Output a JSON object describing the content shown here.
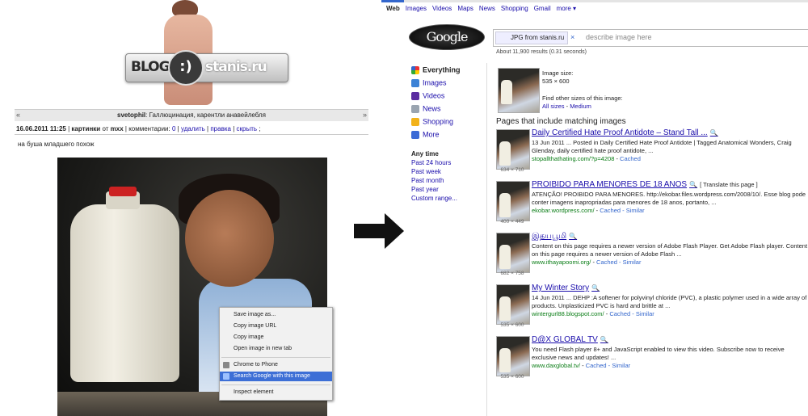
{
  "left": {
    "logo": {
      "left": "BLOG",
      "mid": ":)",
      "right": "stanis.ru"
    },
    "post_nav": {
      "prev": "«",
      "next": "»"
    },
    "post_author": "svetophil",
    "post_title_rest": ": Галлюцинация, карентли анавейлебля",
    "meta": {
      "date": "16.06.2011 11:25",
      "sep1": "|",
      "category": "картинки",
      "from": "от",
      "user": "mxx",
      "sep2": "|",
      "comments": "комментарии:",
      "comments_count": "0",
      "sep3": "|",
      "delete": "удалить",
      "sep4": "|",
      "edit": "правка",
      "sep5": "|",
      "hide": "скрыть",
      "end": ";"
    },
    "post_text": "на буша младшего похож",
    "context_menu": [
      "Save image as...",
      "Copy image URL",
      "Copy image",
      "Open image in new tab",
      "Chrome to Phone",
      "Search Google with this image",
      "Inspect element"
    ]
  },
  "right": {
    "nav": [
      "Web",
      "Images",
      "Videos",
      "Maps",
      "News",
      "Shopping",
      "Gmail",
      "more ▾"
    ],
    "logo": "Google",
    "chip": "JPG from stanis.ru",
    "chip_close": "×",
    "placeholder": "describe image here",
    "results_count": "About 11,900 results (0.31 seconds)",
    "sidebar": [
      "Everything",
      "Images",
      "Videos",
      "News",
      "Shopping",
      "More"
    ],
    "time": [
      "Any time",
      "Past 24 hours",
      "Past week",
      "Past month",
      "Past year",
      "Custom range..."
    ],
    "image_size_label": "Image size:",
    "image_size": "535 × 600",
    "find_other": "Find other sizes of this image:",
    "all_sizes": "All sizes",
    "dash": " - ",
    "medium": "Medium",
    "section": "Pages that include matching images",
    "translate": "[ Translate this page ]",
    "results": [
      {
        "title": "Daily Certified Hate Proof Antidote – Stand Tall ...",
        "snippet": "13 Jun 2011 ... Posted in Daily Certified Hate Proof Antidote | Tagged Anatomical Wonders, Craig Glenday, daily certified hate proof antidote, ...",
        "url": "stopallthathating.com/?p=4208",
        "links": "Cached",
        "dims": "634 × 710"
      },
      {
        "title": "PROIBIDO PARA MENORES DE 18 ANOS",
        "snippet": "ATENÇÃO! PROIBIDO PARA MENORES. http://ekobar.files.wordpress.com/2008/10/. Esse blog pode conter imagens inapropriadas para menores de 18 anos, portanto, ...",
        "url": "ekobar.wordpress.com/",
        "links": "Cached - Similar",
        "dims": "400 × 449"
      },
      {
        "title": "இதயபூமி",
        "snippet": "Content on this page requires a newer version of Adobe Flash Player. Get Adobe Flash player. Content on this page requires a newer version of Adobe Flash ...",
        "url": "www.ithayapoomi.org/",
        "links": "Cached - Similar",
        "dims": "682 × 758"
      },
      {
        "title": "My Winter Story",
        "snippet": "14 Jun 2011 ... DEHP :A softener for polyvinyl chloride (PVC), a plastic polymer used in a wide array of products. Unplasticized PVC is hard and brittle at ...",
        "url": "wintergurl88.blogspot.com/",
        "links": "Cached - Similar",
        "dims": "535 × 600"
      },
      {
        "title": "D@X GLOBAL TV",
        "snippet": "You need Flash player 8+ and JavaScript enabled to view this video. Subscribe now to receive exclusive news and updates! ...",
        "url": "www.daxglobal.tv/",
        "links": "Cached - Similar",
        "dims": "535 × 600"
      }
    ]
  },
  "colors": {
    "link": "#1a0dab",
    "url_green": "#0a7d16",
    "menu_highlight": "#3d6fd6"
  }
}
